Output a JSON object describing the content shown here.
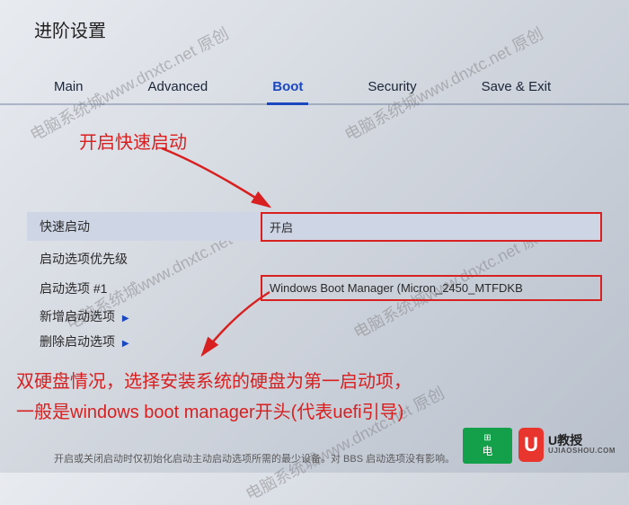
{
  "header": {
    "title": "进阶设置"
  },
  "tabs": {
    "main": "Main",
    "advanced": "Advanced",
    "boot": "Boot",
    "security": "Security",
    "save_exit": "Save & Exit"
  },
  "annotations": {
    "fast_boot": "开启快速启动",
    "dual_disk_line1": "双硬盘情况，选择安装系统的硬盘为第一启动项，",
    "dual_disk_line2": "一般是windows boot manager开头(代表uefi引导)"
  },
  "settings": {
    "fast_boot": {
      "label": "快速启动",
      "value": "开启"
    },
    "boot_priority": {
      "label": "启动选项优先级"
    },
    "boot_option1": {
      "label": "启动选项 #1",
      "value": "Windows Boot Manager (Micron_2450_MTFDKB"
    },
    "add_boot": {
      "label": "新增启动选项"
    },
    "delete_boot": {
      "label": "删除启动选项"
    }
  },
  "footer": {
    "help": "开启或关闭启动时仅初始化启动主动启动选项所需的最少设备。对 BBS 启动选项没有影响。"
  },
  "watermark": "电脑系统城www.dnxtc.net 原创",
  "brands": {
    "box1": "电",
    "box2_main": "U教授",
    "box2_sub": "UJIAOSHOU.COM",
    "box2_icon": "U"
  }
}
